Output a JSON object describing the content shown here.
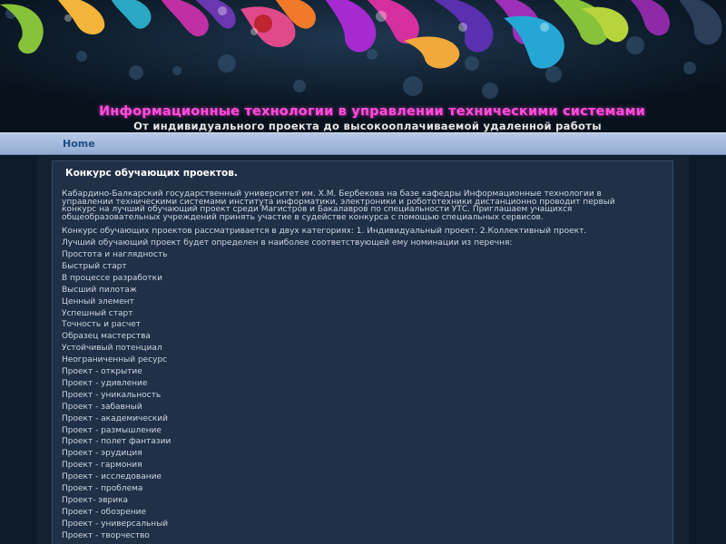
{
  "header": {
    "title": "Информационные технологии в управлении техническими системами",
    "subtitle": "От индивидуального проекта до высокооплачиваемой удаленной работы"
  },
  "nav": {
    "home": "Home"
  },
  "post": {
    "title": "Конкурс обучающих проектов.",
    "intro": "Кабардино-Балкарский государственный университет им. Х.М. Бербекова на базе кафедры Информационные технологии в управлении техническими системами института информатики, электроники и робототехники дистанционно проводит первый конкурс на лучший обучающий проект среди Магистров и Бакалавров по специальности УТС. Приглашаем учащихся общеобразовательных учреждений принять участие в судействе конкурса с помощью специальных сервисов.",
    "categories": "Конкурс обучающих проектов рассматривается в двух категориях: 1. Индивидуальный проект. 2.Коллективный проект.",
    "nominations_intro": "Лучший обучающий проект будет определен в наиболее соответствующей ему номинации из перечня:",
    "nominations": [
      "Простота и наглядность",
      "Быстрый старт",
      "В процессе разработки",
      "Высший пилотаж",
      "Ценный элемент",
      "Успешный старт",
      "Точность и расчет",
      "Образец мастерства",
      "Устойчивый потенциал",
      "Неограниченный ресурс",
      "Проект - открытие",
      "Проект - удивление",
      "Проект - уникальность",
      "Проект - забавный",
      "Проект - академический",
      "Проект - размышление",
      "Проект - полет фантазии",
      "Проект - эрудиция",
      "Проект - гармония",
      "Проект - исследование",
      "Проект - проблема",
      "Проект- эврика",
      "Проект - обозрение",
      "Проект - универсальный",
      "Проект - творчество"
    ]
  },
  "colors": {
    "title_pink": "#ff4fd8",
    "nav_bar": "#a7bcdf",
    "content_bg": "#1f3047"
  }
}
